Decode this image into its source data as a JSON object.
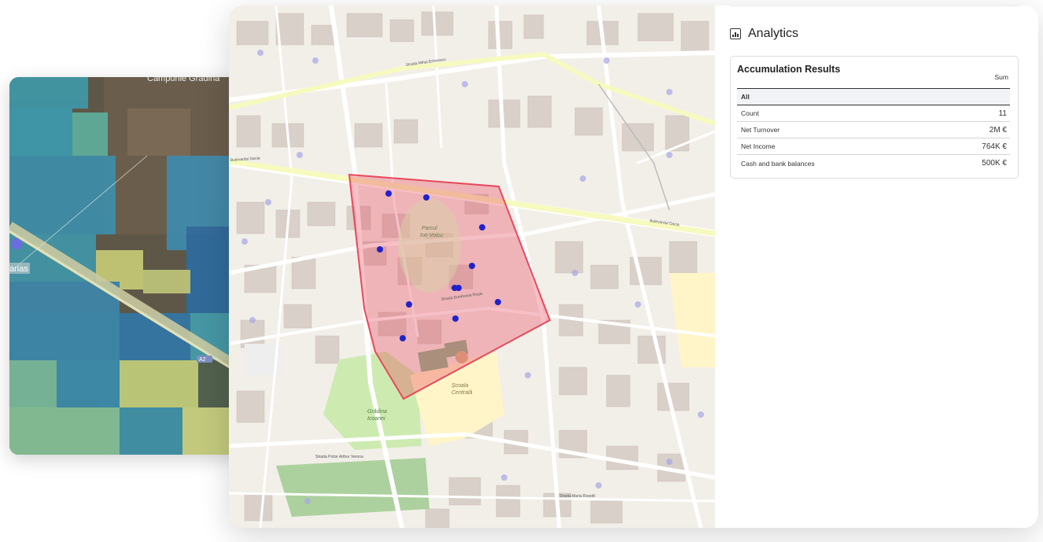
{
  "satellite_card": {
    "label_top": "Campurile Gradina",
    "label_left": "arias",
    "road_badge": "A2"
  },
  "map": {
    "labels": {
      "boulevard_dacia_left": "Bulevardul Dacia",
      "boulevard_dacia_right": "Bulevardul Dacia",
      "strada_mihai_eminescu": "Strada Mihai Eminescu",
      "park_name_1": "Parcul",
      "park_name_2": "Ion Voicu",
      "gradina_1": "Grădina",
      "gradina_2": "Icoanei",
      "scoala_1": "Școala",
      "scoala_2": "Centrală",
      "strada_pictor_verona": "Strada Pictor Arthur Verona",
      "strada_dumbrava_rosie": "Strada Dumbrava Roșie",
      "strada_maria_rosetti": "Strada Maria Rosetti"
    },
    "polygon_color": "#e8495c",
    "marker_color": "#2222cc"
  },
  "panel": {
    "title": "Analytics",
    "icon": "chart-icon",
    "results": {
      "title": "Accumulation Results",
      "column_header": "Sum",
      "group": "All",
      "rows": [
        {
          "label": "Count",
          "value": "11"
        },
        {
          "label": "Net Turnover",
          "value": "2M €"
        },
        {
          "label": "Net Income",
          "value": "764K €"
        },
        {
          "label": "Cash and bank balances",
          "value": "500K €"
        }
      ]
    }
  }
}
